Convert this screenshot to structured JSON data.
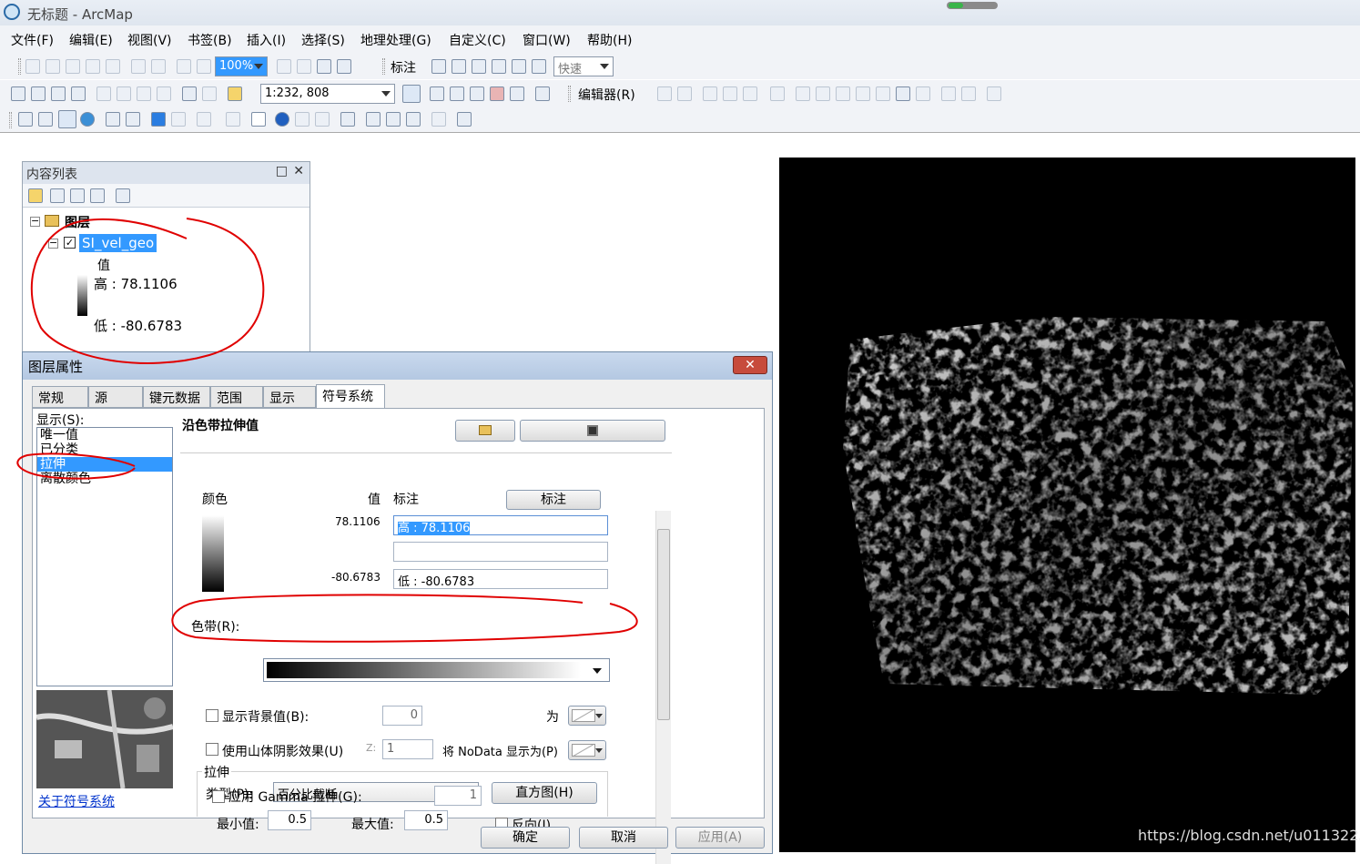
{
  "window": {
    "title": "无标题 - ArcMap"
  },
  "menu": [
    "文件(F)",
    "编辑(E)",
    "视图(V)",
    "书签(B)",
    "插入(I)",
    "选择(S)",
    "地理处理(G)",
    "自定义(C)",
    "窗口(W)",
    "帮助(H)"
  ],
  "toolbar1": {
    "zoom_value": "100%",
    "label_menu": "标注",
    "speed_value": "快速"
  },
  "toolbar2": {
    "scale_value": "1:232, 808",
    "editor_menu": "编辑器(R)"
  },
  "toc": {
    "title": "内容列表",
    "group_label": "图层",
    "layer_name": "SI_vel_geo",
    "value_header": "值",
    "high_label": "高 : 78.1106",
    "low_label": "低 : -80.6783"
  },
  "dialog": {
    "title": "图层属性",
    "close_glyph": "✕",
    "tabs": [
      "常规",
      "源",
      "键元数据",
      "范围",
      "显示",
      "符号系统"
    ],
    "show_label": "显示(S):",
    "render_types": [
      "唯一值",
      "已分类",
      "拉伸",
      "离散颜色"
    ],
    "selected_type": "拉伸",
    "section_title": "沿色带拉伸值",
    "col_color": "颜色",
    "col_value": "值",
    "col_label": "标注",
    "label_button": "标注",
    "high_value": "78.1106",
    "high_text": "高 : 78.1106",
    "mid_text": "",
    "low_value": "-80.6783",
    "low_text": "低 : -80.6783",
    "color_ramp_label": "色带(R):",
    "show_background_label": "显示背景值(B):",
    "background_value": "0",
    "as_label": "为",
    "hillshade_label": "使用山体阴影效果(U)",
    "z_label": "Z:",
    "z_value": "1",
    "nodata_label": "将 NoData 显示为(P)",
    "stretch_group": "拉伸",
    "type_label": "类型(P):",
    "type_value": "百分比截断",
    "histogram_button": "直方图(H)",
    "min_label": "最小值:",
    "min_value": "0.5",
    "max_label": "最大值:",
    "max_value": "0.5",
    "invert_label": "反向(I)",
    "gamma_label": "应用 Gamma 拉伸(G):",
    "gamma_value": "1",
    "stats_label": "统计数据",
    "about_link": "关于符号系统",
    "ok": "确定",
    "cancel": "取消",
    "apply": "应用(A)"
  },
  "watermark": "https://blog.csdn.net/u011322358",
  "colors": {
    "annotation": "#e00000",
    "selection": "#3399ff",
    "map_bg": "#000000"
  }
}
